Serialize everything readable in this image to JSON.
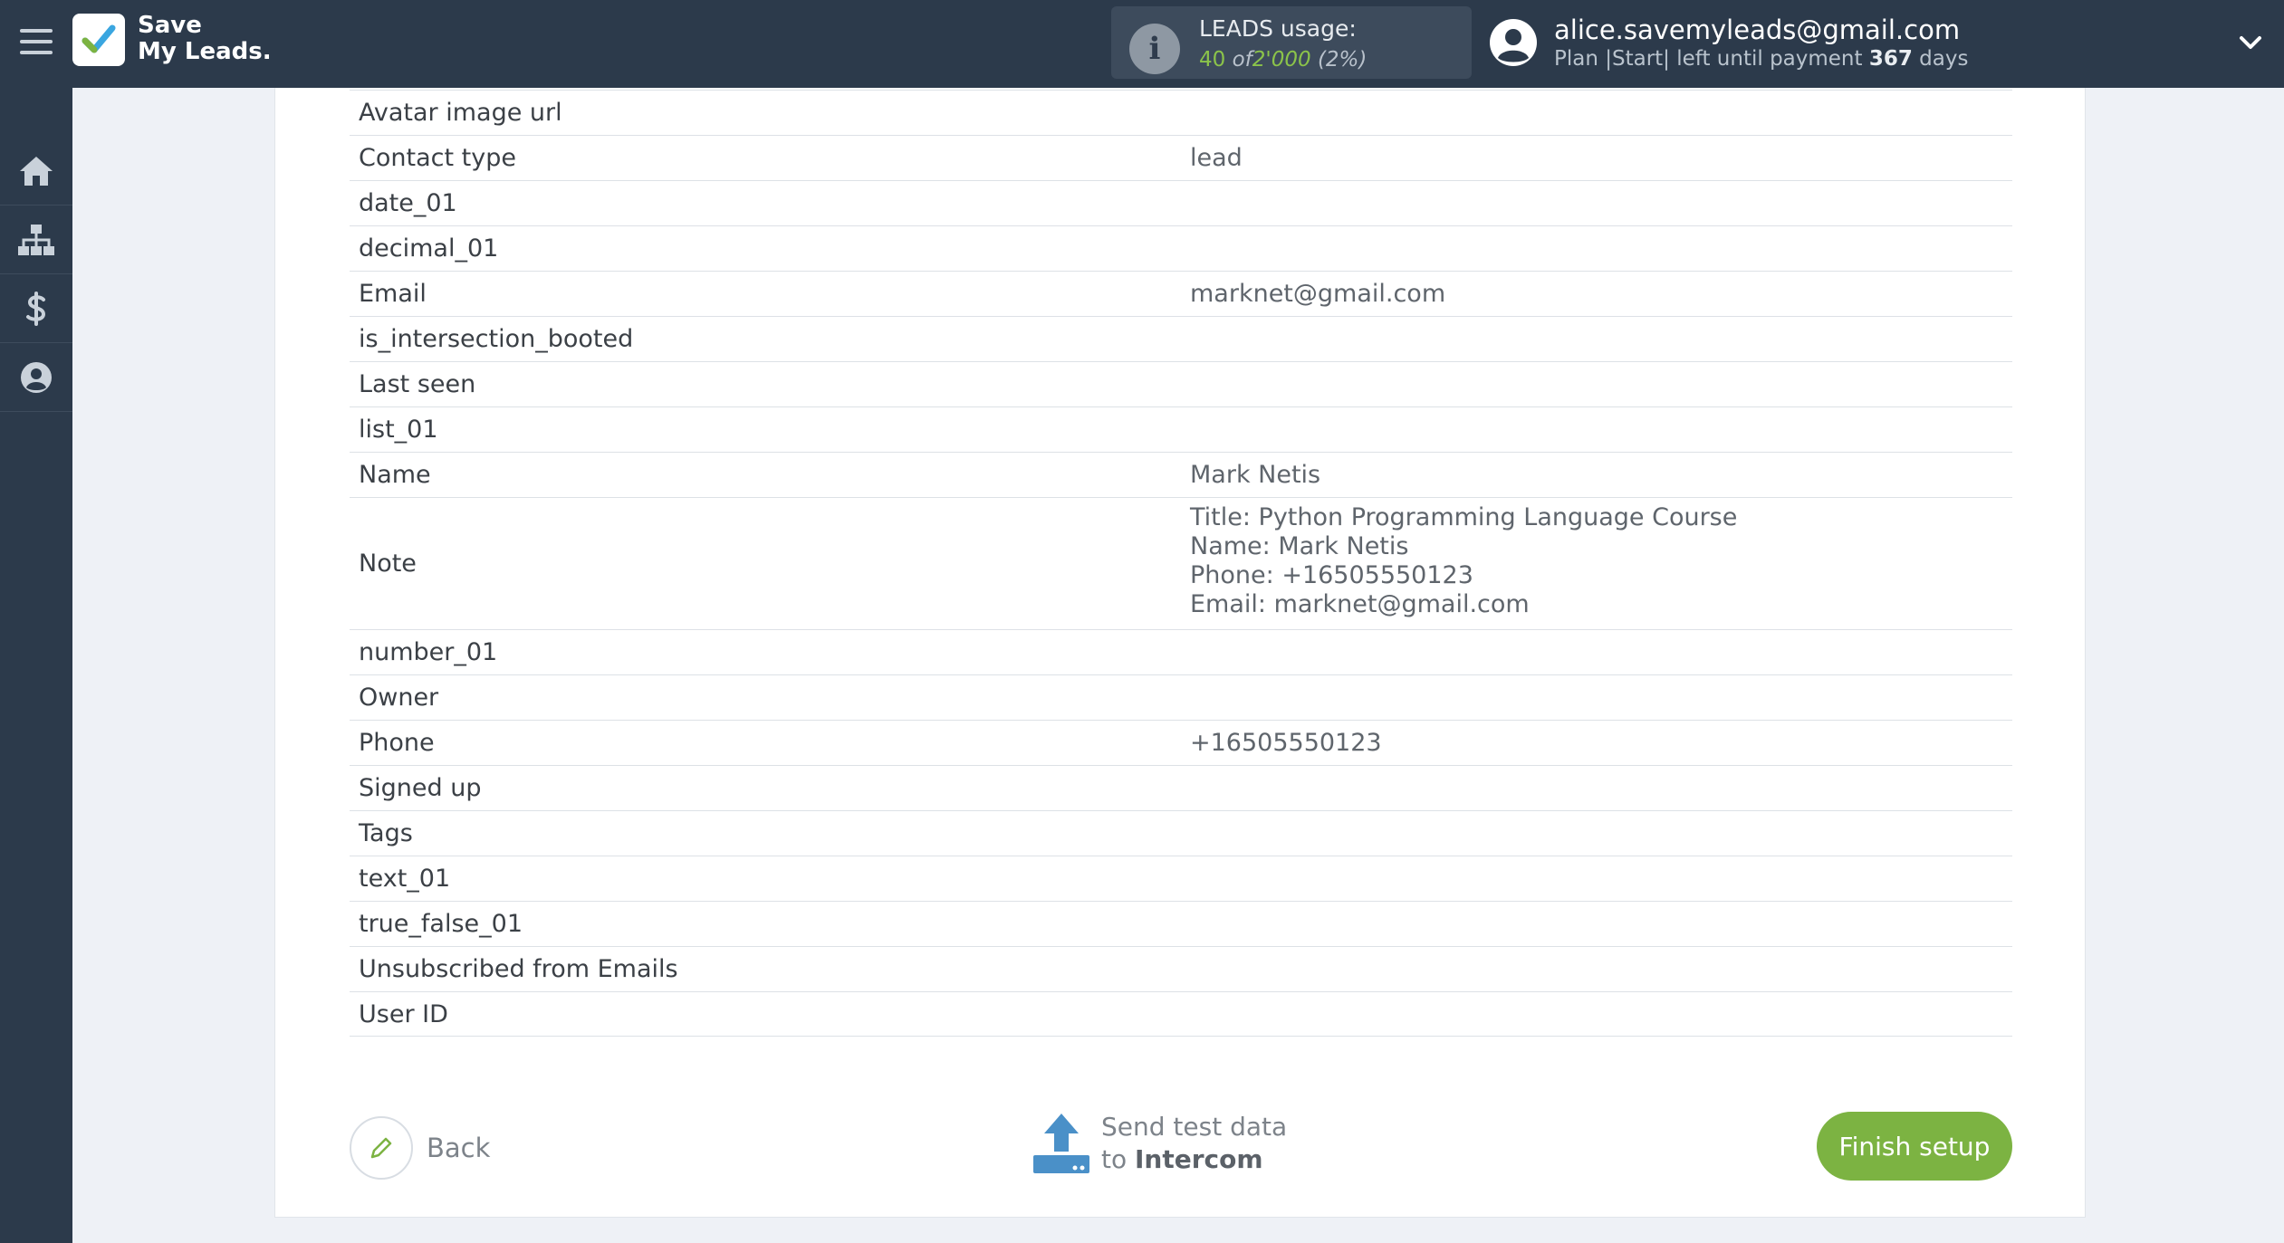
{
  "header": {
    "logo_line1": "Save",
    "logo_line2": "My Leads.",
    "usage_label": "LEADS usage:",
    "usage_used": "40",
    "usage_of": "of",
    "usage_total": "2'000",
    "usage_percent": "(2%)",
    "user_email": "alice.savemyleads@gmail.com",
    "plan_prefix": "Plan |Start| left until payment",
    "plan_days": "367",
    "plan_suffix": "days"
  },
  "sidebar": {
    "items": [
      {
        "icon": "home-icon"
      },
      {
        "icon": "sitemap-icon"
      },
      {
        "icon": "dollar-icon"
      },
      {
        "icon": "user-icon"
      }
    ]
  },
  "fields": [
    {
      "name": "Avatar image url",
      "value": ""
    },
    {
      "name": "Contact type",
      "value": "lead"
    },
    {
      "name": "date_01",
      "value": ""
    },
    {
      "name": "decimal_01",
      "value": ""
    },
    {
      "name": "Email",
      "value": "marknet@gmail.com"
    },
    {
      "name": "is_intersection_booted",
      "value": ""
    },
    {
      "name": "Last seen",
      "value": ""
    },
    {
      "name": "list_01",
      "value": ""
    },
    {
      "name": "Name",
      "value": "Mark Netis"
    },
    {
      "name": "Note",
      "value_lines": [
        "Title: Python Programming Language Course",
        "Name: Mark Netis",
        "Phone: +16505550123",
        "Email: marknet@gmail.com"
      ]
    },
    {
      "name": "number_01",
      "value": ""
    },
    {
      "name": "Owner",
      "value": ""
    },
    {
      "name": "Phone",
      "value": "+16505550123"
    },
    {
      "name": "Signed up",
      "value": ""
    },
    {
      "name": "Tags",
      "value": ""
    },
    {
      "name": "text_01",
      "value": ""
    },
    {
      "name": "true_false_01",
      "value": ""
    },
    {
      "name": "Unsubscribed from Emails",
      "value": ""
    },
    {
      "name": "User ID",
      "value": ""
    }
  ],
  "footer": {
    "back_label": "Back",
    "send_line1": "Send test data",
    "send_to": "to",
    "send_target": "Intercom",
    "finish_label": "Finish setup"
  },
  "colors": {
    "topbar": "#2c3a4b",
    "accent_green": "#7cb342",
    "send_icon_blue": "#4a90c8"
  }
}
